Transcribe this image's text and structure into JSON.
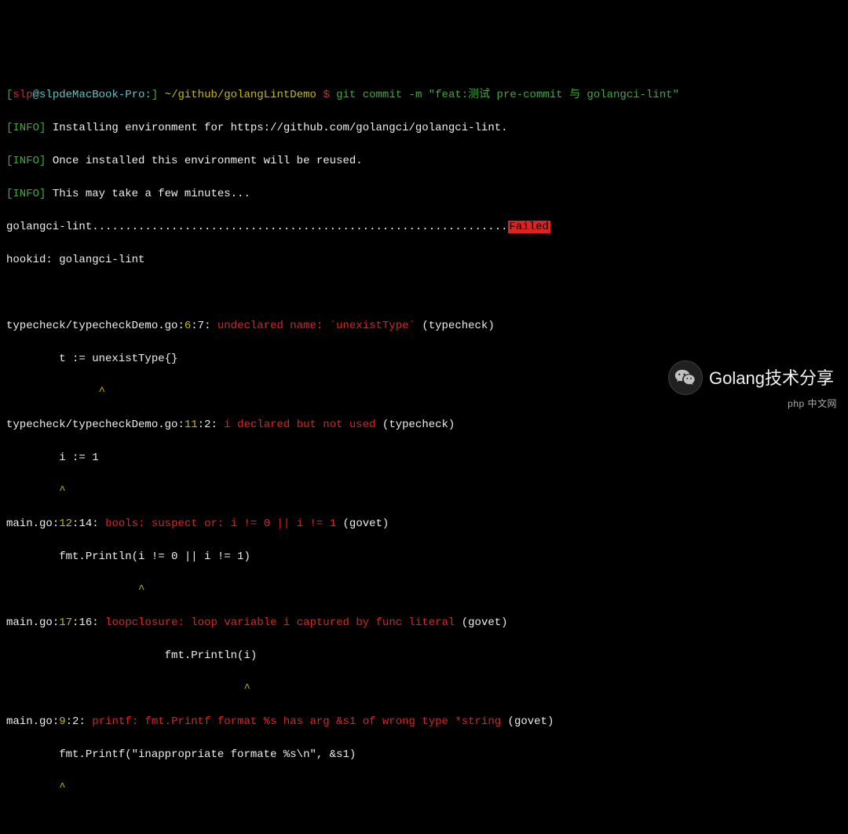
{
  "prompt": {
    "open_bracket": "[",
    "user": "slp",
    "at": "@",
    "host": "slpdeMacBook-Pro:",
    "close_bracket": "]",
    "cwd": " ~/github/golangLintDemo ",
    "dollar": "$ ",
    "command": "git commit -m \"feat:测试 pre-commit 与 golangci-lint\""
  },
  "info_lines": [
    {
      "tag": "[INFO]",
      "text": " Installing environment for https://github.com/golangci/golangci-lint."
    },
    {
      "tag": "[INFO]",
      "text": " Once installed this environment will be reused."
    },
    {
      "tag": "[INFO]",
      "text": " This may take a few minutes..."
    }
  ],
  "run": {
    "name": "golangci-lint",
    "dots": "...............................................................",
    "status": "Failed"
  },
  "hookid": "hookid: golangci-lint",
  "issues": [
    {
      "file": "typecheck/typecheckDemo.go",
      "line": "6",
      "col": "7",
      "msg": "undeclared name: `unexistType`",
      "suffix": " (typecheck)",
      "code": "        t := unexistType{}",
      "caret": "              ^"
    },
    {
      "file": "typecheck/typecheckDemo.go",
      "line": "11",
      "col": "2",
      "msg": "i declared but not used",
      "suffix": " (typecheck)",
      "code": "        i := 1",
      "caret": "        ^"
    },
    {
      "file": "main.go",
      "line": "12",
      "col": "14",
      "msg": "bools: suspect or: i != 0 || i != 1",
      "suffix": " (govet)",
      "code": "        fmt.Println(i != 0 || i != 1)",
      "caret": "                    ^"
    },
    {
      "file": "main.go",
      "line": "17",
      "col": "16",
      "msg": "loopclosure: loop variable i captured by func literal",
      "suffix": " (govet)",
      "code": "                        fmt.Println(i)",
      "caret": "                                    ^"
    },
    {
      "file": "main.go",
      "line": "9",
      "col": "2",
      "msg": "printf: fmt.Printf format %s has arg &s1 of wrong type *string",
      "suffix": " (govet)",
      "code": "        fmt.Printf(\"inappropriate formate %s\\n\", &s1)",
      "caret": "        ^"
    }
  ],
  "watermark": {
    "text": "Golang技术分享",
    "brand": "php 中文网"
  }
}
